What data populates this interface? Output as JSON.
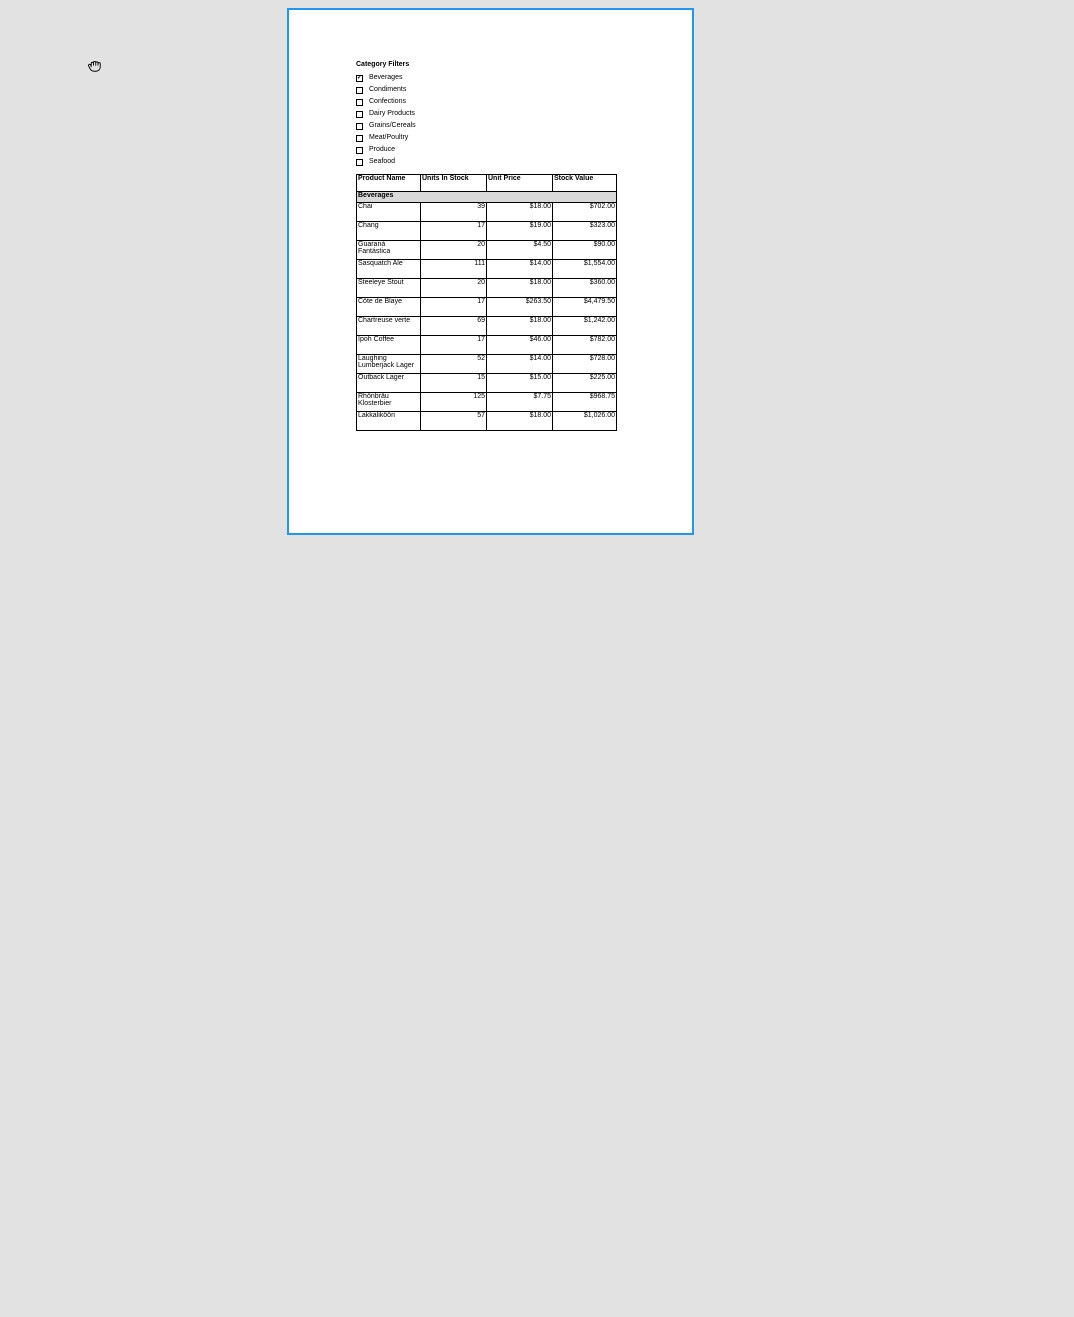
{
  "filters": {
    "title": "Category Filters",
    "items": [
      {
        "label": "Beverages",
        "checked": true
      },
      {
        "label": "Condiments",
        "checked": false
      },
      {
        "label": "Confections",
        "checked": false
      },
      {
        "label": "Dairy Products",
        "checked": false
      },
      {
        "label": "Grains/Cereals",
        "checked": false
      },
      {
        "label": "Meat/Poultry",
        "checked": false
      },
      {
        "label": "Produce",
        "checked": false
      },
      {
        "label": "Seafood",
        "checked": false
      }
    ]
  },
  "table": {
    "headers": {
      "name": "Product Name",
      "units": "Units In Stock",
      "price": "Unit Price",
      "value": "Stock Value"
    },
    "group_label": "Beverages",
    "rows": [
      {
        "name": "Chai",
        "units": "39",
        "price": "$18.00",
        "value": "$702.00"
      },
      {
        "name": "Chang",
        "units": "17",
        "price": "$19.00",
        "value": "$323.00"
      },
      {
        "name": "Guaraná Fantástica",
        "units": "20",
        "price": "$4.50",
        "value": "$90.00"
      },
      {
        "name": "Sasquatch Ale",
        "units": "111",
        "price": "$14.00",
        "value": "$1,554.00"
      },
      {
        "name": "Steeleye Stout",
        "units": "20",
        "price": "$18.00",
        "value": "$360.00"
      },
      {
        "name": "Côte de Blaye",
        "units": "17",
        "price": "$263.50",
        "value": "$4,479.50"
      },
      {
        "name": "Chartreuse verte",
        "units": "69",
        "price": "$18.00",
        "value": "$1,242.00"
      },
      {
        "name": "Ipoh Coffee",
        "units": "17",
        "price": "$46.00",
        "value": "$782.00"
      },
      {
        "name": "Laughing Lumberjack Lager",
        "units": "52",
        "price": "$14.00",
        "value": "$728.00"
      },
      {
        "name": "Outback Lager",
        "units": "15",
        "price": "$15.00",
        "value": "$225.00"
      },
      {
        "name": "Rhönbräu Klosterbier",
        "units": "125",
        "price": "$7.75",
        "value": "$968.75"
      },
      {
        "name": "Lakkalikööri",
        "units": "57",
        "price": "$18.00",
        "value": "$1,026.00"
      }
    ]
  }
}
